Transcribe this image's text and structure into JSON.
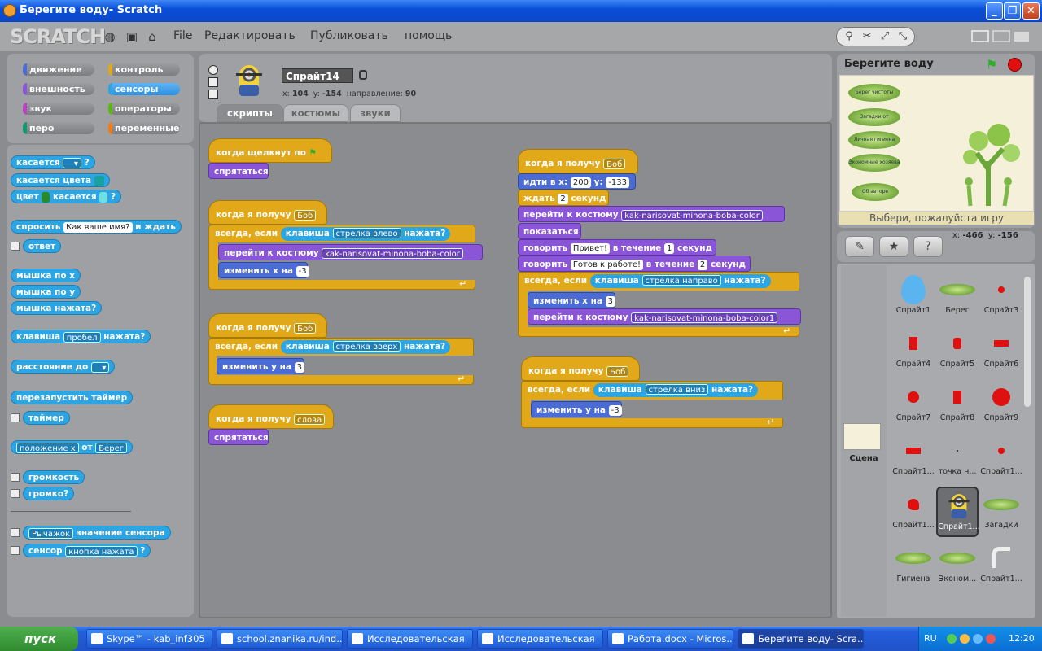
{
  "window": {
    "title": "Берегите воду- Scratch",
    "min": "_",
    "max": "❐",
    "close": "✕"
  },
  "menu": {
    "logo": "SCRATCH",
    "file": "File",
    "edit": "Редактировать",
    "share": "Публиковать",
    "help": "помощь"
  },
  "categories": [
    {
      "label": "движение",
      "color": "#4a6cd4"
    },
    {
      "label": "контроль",
      "color": "#e1a91a"
    },
    {
      "label": "внешность",
      "color": "#8a55d7"
    },
    {
      "label": "сенсоры",
      "color": "#2ca5e2"
    },
    {
      "label": "звук",
      "color": "#bb42c3"
    },
    {
      "label": "операторы",
      "color": "#5cb712"
    },
    {
      "label": "перо",
      "color": "#0e9a6c"
    },
    {
      "label": "переменные",
      "color": "#ee7d16"
    }
  ],
  "palette": {
    "touching": "касается",
    "touching_color": "касается цвета",
    "color": "цвет",
    "touches": "касается",
    "ask": "спросить",
    "ask_default": "Как ваше имя?",
    "and_wait": "и ждать",
    "answer": "ответ",
    "mouse_x": "мышка по x",
    "mouse_y": "мышка по y",
    "mouse_down": "мышка нажата?",
    "key": "клавиша",
    "key_space": "пробел",
    "pressed": "нажата?",
    "distance": "расстояние до",
    "reset_timer": "перезапустить таймер",
    "timer": "таймер",
    "position_x": "положение x",
    "of": "от",
    "of_sprite": "Берег",
    "loudness": "громкость",
    "loud": "громко?",
    "slider": "Рычажок",
    "sensor_value": "значение сенсора",
    "sensor": "сенсор",
    "button_pressed": "кнопка нажата"
  },
  "sprite": {
    "name": "Спрайт14",
    "x_label": "x:",
    "x": "104",
    "y_label": "y:",
    "y": "-154",
    "dir_label": "направление:",
    "dir": "90"
  },
  "tabs": [
    "скрипты",
    "костюмы",
    "звуки"
  ],
  "scripts": {
    "when_flag": "когда щелкнут по",
    "hide": "спрятаться",
    "when_receive": "когда я получу",
    "bob": "Боб",
    "forever_if": "всегда, если",
    "key": "клавиша",
    "left_arrow": "стрелка влево",
    "right_arrow": "стрелка направо",
    "up_arrow": "стрелка вверх",
    "down_arrow": "стрелка вниз",
    "pressed": "нажата?",
    "switch_costume": "перейти к костюму",
    "costume_name": "kak-narisovat-minona-boba-color",
    "costume_name1": "kak-narisovat-minona-boba-color1",
    "change_x": "изменить х на",
    "change_y": "изменить у на",
    "neg3": "-3",
    "pos3": "3",
    "words": "слова",
    "goto_x": "идти в x:",
    "goto_y": "y:",
    "x200": "200",
    "y_neg133": "-133",
    "wait": "ждать",
    "two": "2",
    "one": "1",
    "seconds": "секунд",
    "show": "показаться",
    "say": "говорить",
    "hello": "Привет!",
    "ready": "Готов к работе!",
    "for": "в течение"
  },
  "stage": {
    "title": "Берегите воду",
    "footer": "Выбери, пожалуйста игру",
    "mouse_x_label": "x:",
    "mouse_x": "-466",
    "mouse_y_label": "y:",
    "mouse_y": "-156",
    "leaves": [
      "Берег чистоты",
      "Загадки от Капельки",
      "Личная гигиена",
      "Экономные хозяева",
      "Об авторе"
    ]
  },
  "stage_thumb": "Сцена",
  "sprites": [
    "Спрайт1",
    "Берег",
    "Спрайт3",
    "Спрайт4",
    "Спрайт5",
    "Спрайт6",
    "Спрайт7",
    "Спрайт8",
    "Спрайт9",
    "Спрайт1...",
    "точка н...",
    "Спрайт1...",
    "Спрайт1...",
    "Спрайт1...",
    "Загадки",
    "Гигиена",
    "Эконом...",
    "Спрайт1..."
  ],
  "taskbar": {
    "start": "пуск",
    "tasks": [
      "Skype™ - kab_inf305",
      "school.znanika.ru/ind...",
      "Исследовательская",
      "Исследовательская",
      "Работа.docx - Micros...",
      "Берегите воду- Scra..."
    ],
    "lang": "RU",
    "time": "12:20"
  }
}
